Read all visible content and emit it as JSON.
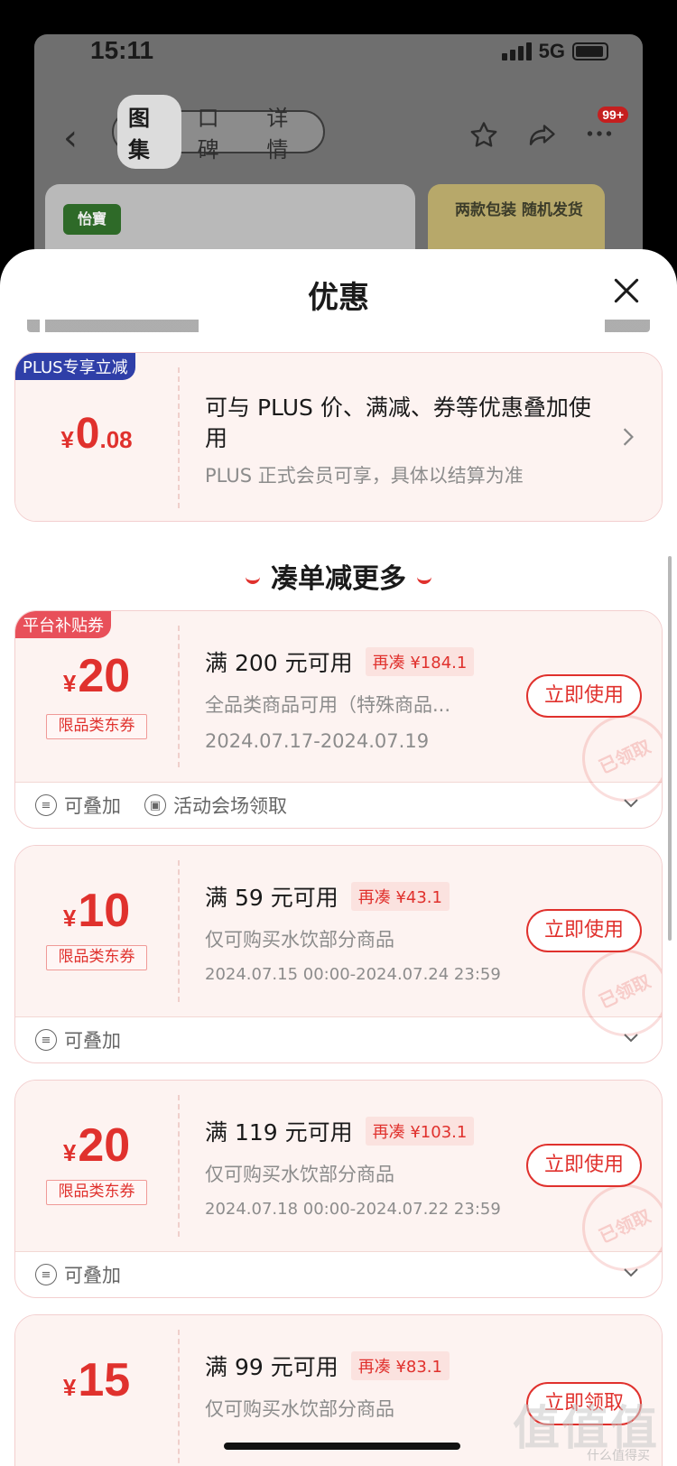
{
  "status_bar": {
    "time": "15:11",
    "network": "5G"
  },
  "nav": {
    "tabs": [
      {
        "label": "图集",
        "active": true
      },
      {
        "label": "口碑",
        "active": false
      },
      {
        "label": "详情",
        "active": false
      }
    ],
    "badge": "99+"
  },
  "background": {
    "logo_text": "怡寶",
    "banner_text": "两款包装 随机发货"
  },
  "sheet": {
    "title": "优惠"
  },
  "plus_card": {
    "corner_tag": "PLUS专享立减",
    "currency": "¥",
    "amount_int": "0",
    "amount_dec": ".08",
    "main_text": "可与 PLUS 价、满减、券等优惠叠加使用",
    "sub_text": "PLUS 正式会员可享，具体以结算为准"
  },
  "section": {
    "title": "凑单减更多"
  },
  "coupons": [
    {
      "corner_tag": "平台补贴券",
      "currency": "¥",
      "amount": "20",
      "limit_tag": "限品类东券",
      "condition": "满 200 元可用",
      "need_more": "再凑 ¥184.1",
      "desc": "全品类商品可用（特殊商品...",
      "date": "2024.07.17-2024.07.19",
      "button": "立即使用",
      "stamp": "已领取",
      "features": [
        "可叠加",
        "活动会场领取"
      ]
    },
    {
      "corner_tag": "",
      "currency": "¥",
      "amount": "10",
      "limit_tag": "限品类东券",
      "condition": "满 59 元可用",
      "need_more": "再凑 ¥43.1",
      "desc": "仅可购买水饮部分商品",
      "date": "2024.07.15 00:00-2024.07.24 23:59",
      "button": "立即使用",
      "stamp": "已领取",
      "features": [
        "可叠加"
      ]
    },
    {
      "corner_tag": "",
      "currency": "¥",
      "amount": "20",
      "limit_tag": "限品类东券",
      "condition": "满 119 元可用",
      "need_more": "再凑 ¥103.1",
      "desc": "仅可购买水饮部分商品",
      "date": "2024.07.18 00:00-2024.07.22 23:59",
      "button": "立即使用",
      "stamp": "已领取",
      "features": [
        "可叠加"
      ]
    },
    {
      "corner_tag": "",
      "currency": "¥",
      "amount": "15",
      "limit_tag": "",
      "condition": "满 99 元可用",
      "need_more": "再凑 ¥83.1",
      "desc": "仅可购买水饮部分商品",
      "date": "",
      "button": "立即领取",
      "stamp": "",
      "features": []
    }
  ],
  "watermark": {
    "text": "值值值",
    "sub": "什么值得买"
  },
  "colors": {
    "accent": "#e0312d",
    "plus_tag": "#2f3fa8",
    "platform_tag": "#e8505a"
  }
}
